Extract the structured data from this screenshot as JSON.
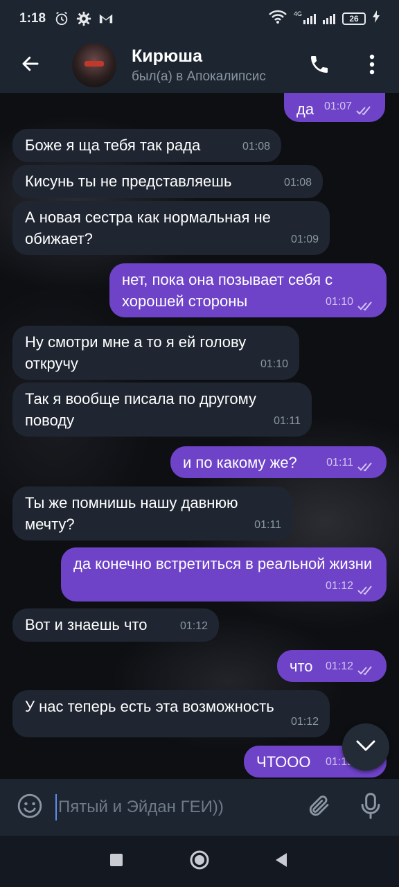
{
  "status_bar": {
    "time": "1:18",
    "network_label": "4G",
    "battery": "26"
  },
  "header": {
    "contact_name": "Кирюша",
    "contact_status": "был(а) в Апокалипсис"
  },
  "icons": {
    "back": "arrow-left-icon",
    "call": "phone-icon",
    "menu": "more-vertical-icon",
    "emoji": "smiley-icon",
    "attach": "paperclip-icon",
    "mic": "microphone-icon",
    "scroll": "chevron-down-icon"
  },
  "colors": {
    "incoming_bubble": "#1f2631",
    "outgoing_bubble": "#6e43c8",
    "header": "#1d2530",
    "accent": "#5c8ef0"
  },
  "messages": [
    {
      "direction": "out",
      "text": "да",
      "time": "01:07",
      "read": true
    },
    {
      "direction": "in",
      "text": "Боже я ща тебя так рада",
      "time": "01:08"
    },
    {
      "direction": "in",
      "text": "Кисунь ты не представляешь",
      "time": "01:08"
    },
    {
      "direction": "in",
      "text": "А новая сестра как нормальная не обижает?",
      "time": "01:09"
    },
    {
      "direction": "out",
      "text": "нет, пока она позывает себя с хорошей стороны",
      "time": "01:10",
      "read": true
    },
    {
      "direction": "in",
      "text": "Ну смотри мне а то я ей голову откручу",
      "time": "01:10"
    },
    {
      "direction": "in",
      "text": "Так я вообще писала по другому поводу",
      "time": "01:11"
    },
    {
      "direction": "out",
      "text": "и по какому же?",
      "time": "01:11",
      "read": true
    },
    {
      "direction": "in",
      "text": "Ты же помнишь нашу давнюю мечту?",
      "time": "01:11"
    },
    {
      "direction": "out",
      "text": "да конечно встретиться в реальной жизни",
      "time": "01:12",
      "read": true
    },
    {
      "direction": "in",
      "text": "Вот и знаешь что",
      "time": "01:12"
    },
    {
      "direction": "out",
      "text": "что",
      "time": "01:12",
      "read": true
    },
    {
      "direction": "in",
      "text": "У нас теперь есть эта возможность",
      "time": "01:12"
    },
    {
      "direction": "out",
      "text": "ЧТООО",
      "time": "01:12",
      "read": true
    }
  ],
  "composer": {
    "placeholder": "Пятый и Эйдан ГЕИ))"
  }
}
